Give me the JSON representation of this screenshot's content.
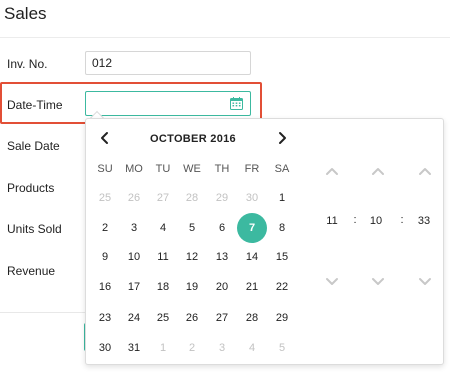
{
  "page": {
    "title": "Sales"
  },
  "form": {
    "inv_label": "Inv. No.",
    "inv_value": "012",
    "datetime_label": "Date-Time",
    "sale_date_label": "Sale Date",
    "products_label": "Products",
    "units_sold_label": "Units Sold",
    "revenue_label": "Revenue"
  },
  "picker": {
    "month_title": "OCTOBER 2016",
    "weekdays": [
      "SU",
      "MO",
      "TU",
      "WE",
      "TH",
      "FR",
      "SA"
    ],
    "weeks": [
      [
        {
          "d": "25",
          "o": true
        },
        {
          "d": "26",
          "o": true
        },
        {
          "d": "27",
          "o": true
        },
        {
          "d": "28",
          "o": true
        },
        {
          "d": "29",
          "o": true
        },
        {
          "d": "30",
          "o": true
        },
        {
          "d": "1",
          "o": false
        }
      ],
      [
        {
          "d": "2",
          "o": false
        },
        {
          "d": "3",
          "o": false
        },
        {
          "d": "4",
          "o": false
        },
        {
          "d": "5",
          "o": false
        },
        {
          "d": "6",
          "o": false
        },
        {
          "d": "7",
          "o": false,
          "sel": true
        },
        {
          "d": "8",
          "o": false
        }
      ],
      [
        {
          "d": "9",
          "o": false
        },
        {
          "d": "10",
          "o": false
        },
        {
          "d": "11",
          "o": false
        },
        {
          "d": "12",
          "o": false
        },
        {
          "d": "13",
          "o": false
        },
        {
          "d": "14",
          "o": false
        },
        {
          "d": "15",
          "o": false
        }
      ],
      [
        {
          "d": "16",
          "o": false
        },
        {
          "d": "17",
          "o": false
        },
        {
          "d": "18",
          "o": false
        },
        {
          "d": "19",
          "o": false
        },
        {
          "d": "20",
          "o": false
        },
        {
          "d": "21",
          "o": false
        },
        {
          "d": "22",
          "o": false
        }
      ],
      [
        {
          "d": "23",
          "o": false
        },
        {
          "d": "24",
          "o": false
        },
        {
          "d": "25",
          "o": false
        },
        {
          "d": "26",
          "o": false
        },
        {
          "d": "27",
          "o": false
        },
        {
          "d": "28",
          "o": false
        },
        {
          "d": "29",
          "o": false
        }
      ],
      [
        {
          "d": "30",
          "o": false
        },
        {
          "d": "31",
          "o": false
        },
        {
          "d": "1",
          "o": true
        },
        {
          "d": "2",
          "o": true
        },
        {
          "d": "3",
          "o": true
        },
        {
          "d": "4",
          "o": true
        },
        {
          "d": "5",
          "o": true
        }
      ]
    ],
    "time": {
      "hour": "11",
      "minute": "10",
      "second": "33",
      "separator": ":"
    },
    "icons": {
      "prev": "chevron-left-icon",
      "next": "chevron-right-icon",
      "calendar": "calendar-icon",
      "up": "chevron-up-icon",
      "down": "chevron-down-icon"
    }
  },
  "colors": {
    "accent": "#3cb9a0",
    "highlight": "#e24f36",
    "muted_day": "#c2c2c2",
    "time_arrow": "#c8c8c8"
  }
}
